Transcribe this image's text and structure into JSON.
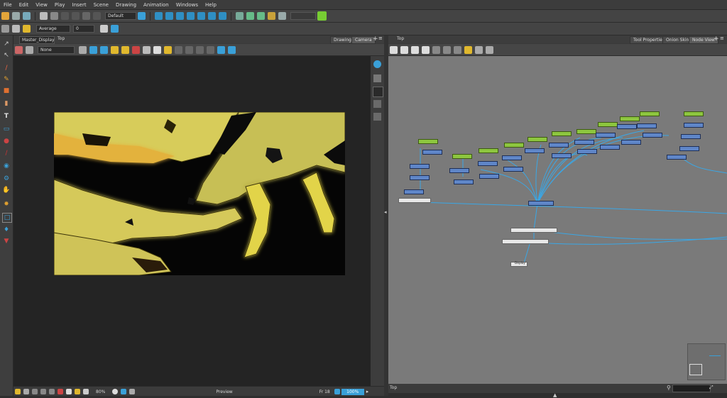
{
  "menu": [
    "File",
    "Edit",
    "View",
    "Play",
    "Insert",
    "Scene",
    "Drawing",
    "Animation",
    "Windows",
    "Help"
  ],
  "toolbar": {
    "workspace": "Default",
    "brush_mode": "Average",
    "brush_value": "0"
  },
  "camera": {
    "tab_drawing": "Drawing",
    "tab_camera": "Camera",
    "display_select": "Master_Display",
    "breadcrumb": "Top",
    "none_select": "None",
    "status_zoom": "80%",
    "status_mode": "Preview",
    "status_frame": "Fr 18",
    "status_percent": "100%"
  },
  "nodeview": {
    "breadcrumb": "Top",
    "tab_tool_properties": "Tool Properties",
    "tab_onion_skin": "Onion Skin",
    "tab_node_view": "Node View",
    "status_path": "Top",
    "display_node": "Display"
  },
  "colors": {
    "accent_blue": "#3aa0d8",
    "node_blue": "#5f86c8",
    "node_green": "#8dc63f",
    "canvas_yellow": "#e8d640"
  }
}
